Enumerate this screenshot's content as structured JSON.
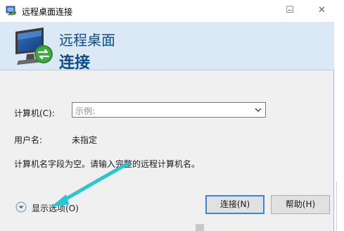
{
  "window": {
    "title": "远程桌面连接",
    "title_icon": "remote-desktop-icon",
    "controls": {
      "minimize": "–",
      "maximize": "☐",
      "close": "✕"
    }
  },
  "banner": {
    "line1": "远程桌面",
    "line2": "连接",
    "icon": "remote-desktop-monitor-icon"
  },
  "form": {
    "computer_label": "计算机(C):",
    "computer_placeholder": "示例:",
    "user_label": "用户名:",
    "user_value": "未指定",
    "hint": "计算机名字段为空。请输入完整的远程计算机名。"
  },
  "options": {
    "label": "显示选项(O)"
  },
  "buttons": {
    "connect": "连接(N)",
    "help": "帮助(H)"
  },
  "colors": {
    "banner_bg": "#dbe9f6",
    "banner_text": "#0b4c8c",
    "arrow": "#26c6d2",
    "default_button_border": "#3f83d6"
  }
}
